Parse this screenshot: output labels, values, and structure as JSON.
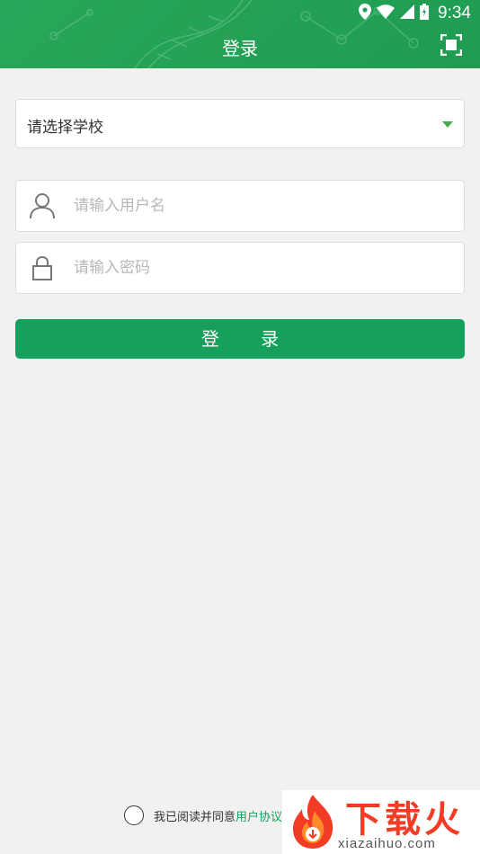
{
  "status_bar": {
    "time": "9:34"
  },
  "header": {
    "title": "登录"
  },
  "school_select": {
    "value": "请选择学校"
  },
  "username": {
    "placeholder": "请输入用户名"
  },
  "password": {
    "placeholder": "请输入密码"
  },
  "login_button": {
    "label": "登 录"
  },
  "agreement": {
    "text": "我已阅读并同意",
    "link": "用户协议"
  },
  "watermark": {
    "cn": "下载火",
    "en": "xiazaihuo.com"
  },
  "colors": {
    "primary": "#16a05c",
    "header": "#23a257",
    "background": "#f0f1f0",
    "watermark": "#f23c26"
  },
  "icons": [
    "location-icon",
    "wifi-icon",
    "signal-icon",
    "battery-icon",
    "scan-icon",
    "caret-down-icon",
    "user-icon",
    "lock-icon"
  ]
}
